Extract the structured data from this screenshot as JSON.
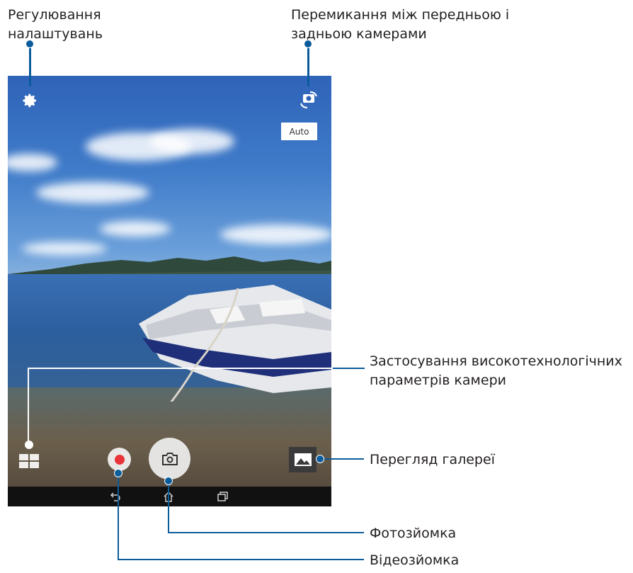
{
  "callouts": {
    "settings": [
      "Регулювання",
      "налаштувань"
    ],
    "switch_camera": [
      "Перемикання між передньою і",
      "задньою камерами"
    ],
    "advanced": [
      "Застосування високотехнологічних",
      "параметрів камери"
    ],
    "gallery": "Перегляд галереї",
    "photo": "Фотозйомка",
    "video": "Відеозйомка"
  },
  "camera_ui": {
    "auto_label": "Auto",
    "icons": {
      "settings": "gear-icon",
      "switch_camera": "camera-switch-icon",
      "modes": "grid-icon",
      "record": "record-icon",
      "shutter": "camera-icon",
      "gallery": "image-icon",
      "back": "back-icon",
      "home": "home-icon",
      "recents": "recents-icon"
    }
  },
  "colors": {
    "callout_line": "#0b5c9b",
    "record_red": "#e8343a"
  }
}
